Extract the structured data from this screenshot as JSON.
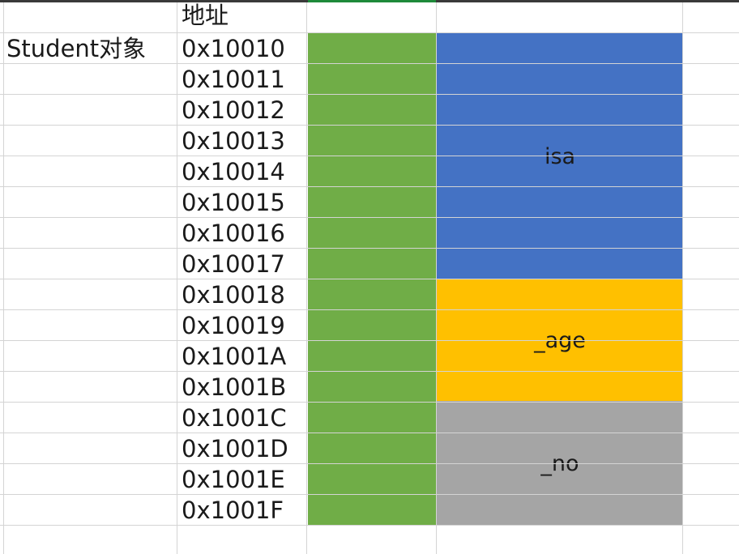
{
  "sheet": {
    "header_label": "地址",
    "object_label": "Student对象",
    "addresses": [
      "0x10010",
      "0x10011",
      "0x10012",
      "0x10013",
      "0x10014",
      "0x10015",
      "0x10016",
      "0x10017",
      "0x10018",
      "0x10019",
      "0x1001A",
      "0x1001B",
      "0x1001C",
      "0x1001D",
      "0x1001E",
      "0x1001F"
    ],
    "fields": [
      {
        "label": "isa",
        "color": "#4472c4"
      },
      {
        "label": "_age",
        "color": "#ffc000"
      },
      {
        "label": "_no",
        "color": "#a5a5a5"
      }
    ],
    "object_block_color": "#70ad47"
  }
}
